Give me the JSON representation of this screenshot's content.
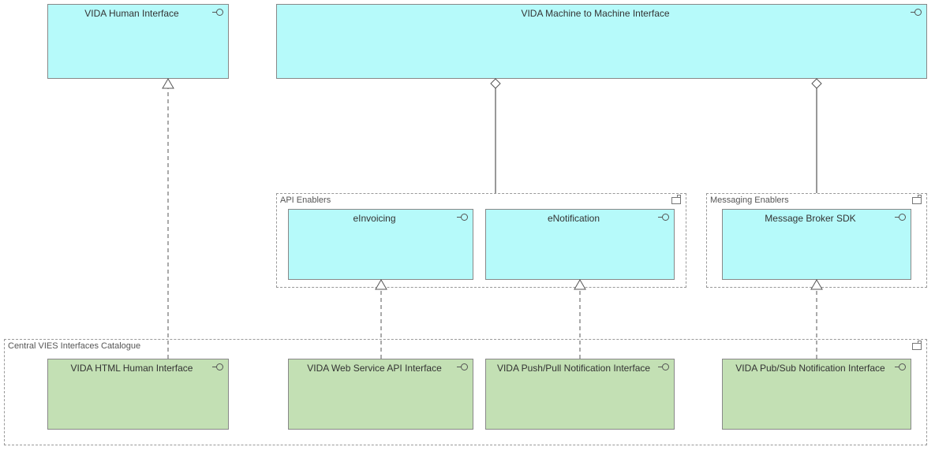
{
  "boxes": {
    "human_iface": "VIDA Human Interface",
    "m2m_iface": "VIDA Machine to Machine Interface",
    "einvoicing": "eInvoicing",
    "enotification": "eNotification",
    "msg_broker": "Message Broker SDK",
    "html_iface": "VIDA HTML Human Interface",
    "ws_api": "VIDA Web Service API Interface",
    "pushpull": "VIDA Push/Pull Notification Interface",
    "pubsub": "VIDA Pub/Sub Notification Interface"
  },
  "groups": {
    "api_enablers": "API Enablers",
    "msg_enablers": "Messaging Enablers",
    "catalogue": "Central VIES Interfaces Catalogue"
  }
}
